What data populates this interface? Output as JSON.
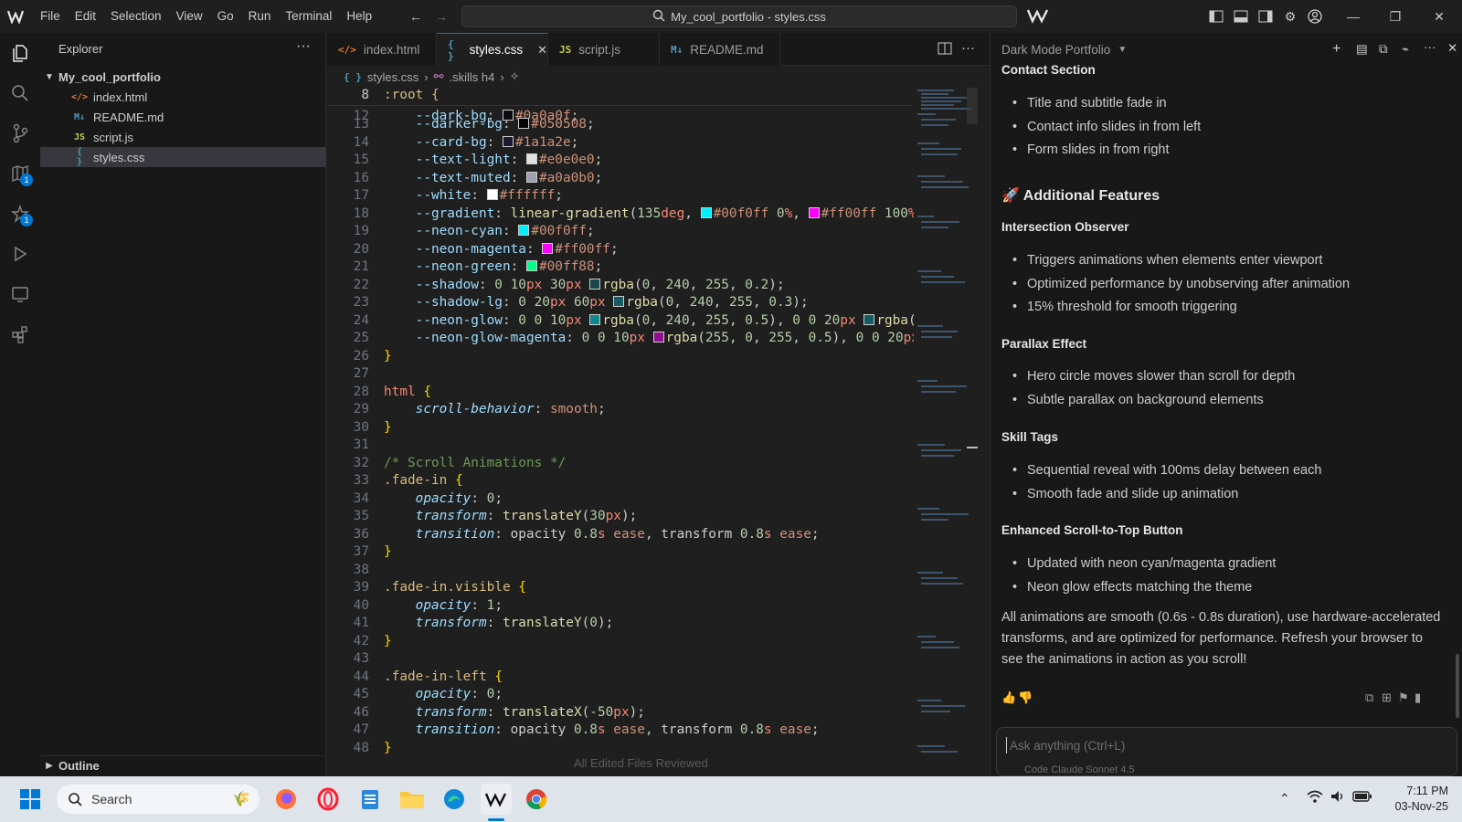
{
  "menu": [
    "File",
    "Edit",
    "Selection",
    "View",
    "Go",
    "Run",
    "Terminal",
    "Help"
  ],
  "search_title": "My_cool_portfolio - styles.css",
  "sidebar": {
    "title": "Explorer",
    "folder": "My_cool_portfolio",
    "files": [
      {
        "icon": "</>",
        "name": "index.html",
        "color": "#e37933"
      },
      {
        "icon": "M↓",
        "name": "README.md",
        "color": "#519aba"
      },
      {
        "icon": "JS",
        "name": "script.js",
        "color": "#cbcb41"
      },
      {
        "icon": "{ }",
        "name": "styles.css",
        "color": "#519aba"
      }
    ],
    "outline": "Outline"
  },
  "tabs": [
    {
      "icon": "</>",
      "label": "index.html",
      "color": "#e37933"
    },
    {
      "icon": "{ }",
      "label": "styles.css",
      "color": "#519aba"
    },
    {
      "icon": "JS",
      "label": "script.js",
      "color": "#cbcb41"
    },
    {
      "icon": "M↓",
      "label": "README.md",
      "color": "#519aba"
    }
  ],
  "breadcrumb": [
    "styles.css",
    ".skills h4"
  ],
  "editor": {
    "sticky_line": "8",
    "sticky_code": ":root {",
    "bottom_hint": "All Edited Files Reviewed"
  },
  "chat": {
    "title": "Dark Mode Portfolio",
    "contact_heading": "Contact Section",
    "contact_items": [
      "Title and subtitle fade in",
      "Contact info slides in from left",
      "Form slides in from right"
    ],
    "additional_heading": "Additional Features",
    "intersection_heading": "Intersection Observer",
    "intersection_items": [
      "Triggers animations when elements enter viewport",
      "Optimized performance by unobserving after animation",
      "15% threshold for smooth triggering"
    ],
    "parallax_heading": "Parallax Effect",
    "parallax_items": [
      "Hero circle moves slower than scroll for depth",
      "Subtle parallax on background elements"
    ],
    "skill_heading": "Skill Tags",
    "skill_items": [
      "Sequential reveal with 100ms delay between each",
      "Smooth fade and slide up animation"
    ],
    "scroll_heading": "Enhanced Scroll-to-Top Button",
    "scroll_items": [
      "Updated with neon cyan/magenta gradient",
      "Neon glow effects matching the theme"
    ],
    "summary": "All animations are smooth (0.6s - 0.8s duration), use hardware-accelerated transforms, and are optimized for performance. Refresh your browser to see the animations in action as you scroll!",
    "input_placeholder": "Ask anything (Ctrl+L)",
    "model_hint": "Code   Claude Sonnet 4.5"
  },
  "taskbar": {
    "search_label": "Search",
    "time": "7:11 PM",
    "date": "03-Nov-25"
  },
  "colors": {
    "accent": "#0078d4",
    "cyan": "#00f0ff",
    "magenta": "#ff00ff",
    "green": "#00ff88"
  }
}
